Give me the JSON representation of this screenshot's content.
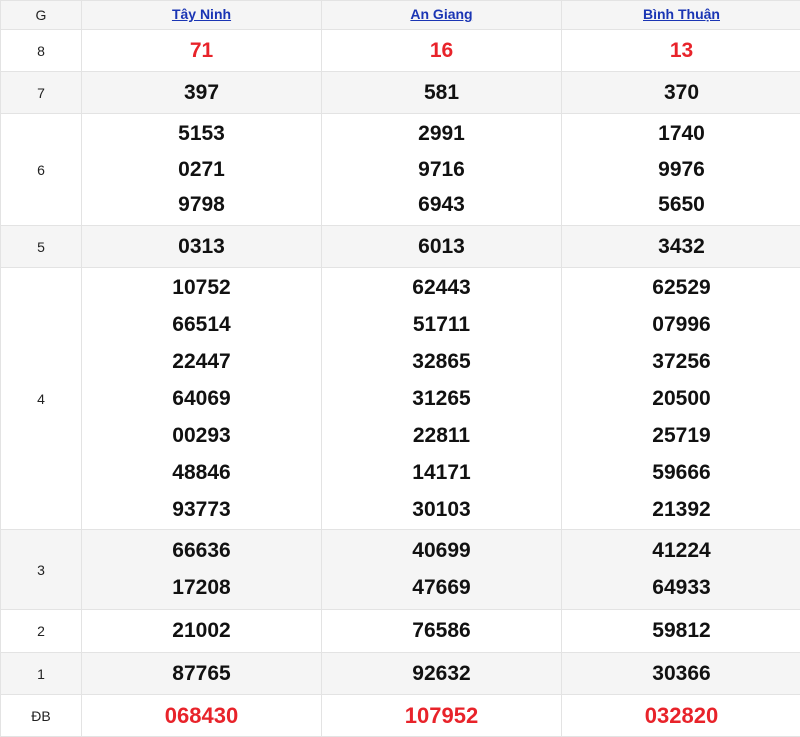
{
  "header": {
    "prize_col": "G",
    "provinces": [
      "Tây Ninh",
      "An Giang",
      "Bình Thuận"
    ]
  },
  "rows": [
    {
      "label": "8",
      "cols": [
        [
          "71"
        ],
        [
          "16"
        ],
        [
          "13"
        ]
      ]
    },
    {
      "label": "7",
      "cols": [
        [
          "397"
        ],
        [
          "581"
        ],
        [
          "370"
        ]
      ]
    },
    {
      "label": "6",
      "cols": [
        [
          "5153",
          "0271",
          "9798"
        ],
        [
          "2991",
          "9716",
          "6943"
        ],
        [
          "1740",
          "9976",
          "5650"
        ]
      ]
    },
    {
      "label": "5",
      "cols": [
        [
          "0313"
        ],
        [
          "6013"
        ],
        [
          "3432"
        ]
      ]
    },
    {
      "label": "4",
      "cols": [
        [
          "10752",
          "66514",
          "22447",
          "64069",
          "00293",
          "48846",
          "93773"
        ],
        [
          "62443",
          "51711",
          "32865",
          "31265",
          "22811",
          "14171",
          "30103"
        ],
        [
          "62529",
          "07996",
          "37256",
          "20500",
          "25719",
          "59666",
          "21392"
        ]
      ]
    },
    {
      "label": "3",
      "cols": [
        [
          "66636",
          "17208"
        ],
        [
          "40699",
          "47669"
        ],
        [
          "41224",
          "64933"
        ]
      ]
    },
    {
      "label": "2",
      "cols": [
        [
          "21002"
        ],
        [
          "76586"
        ],
        [
          "59812"
        ]
      ]
    },
    {
      "label": "1",
      "cols": [
        [
          "87765"
        ],
        [
          "92632"
        ],
        [
          "30366"
        ]
      ]
    },
    {
      "label": "ĐB",
      "cols": [
        [
          "068430"
        ],
        [
          "107952"
        ],
        [
          "032820"
        ]
      ]
    }
  ],
  "colors": {
    "accent_red": "#e8232a",
    "link_blue": "#1a35b4",
    "shade": "#f5f5f5"
  }
}
